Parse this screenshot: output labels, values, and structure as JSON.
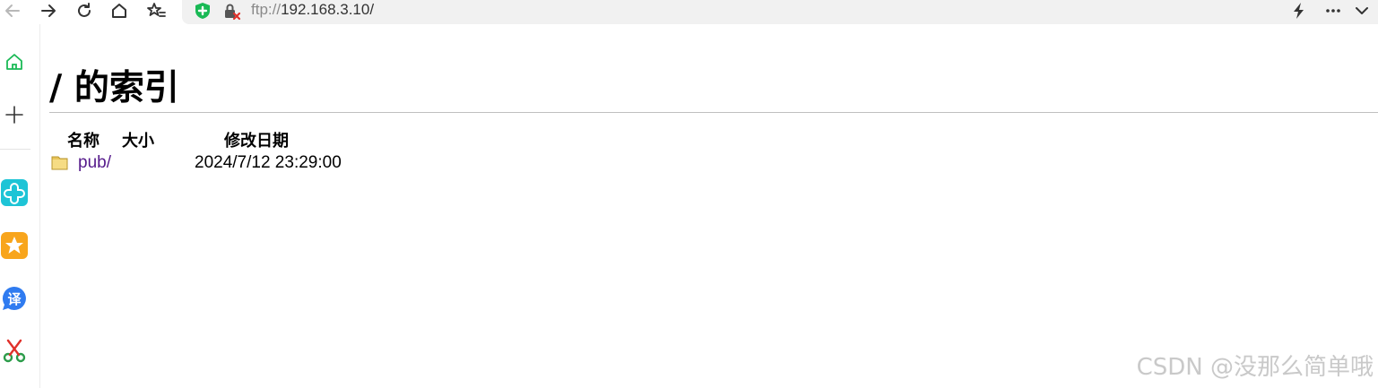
{
  "address_bar": {
    "scheme": "ftp://",
    "host": "192.168.3.10",
    "path": "/"
  },
  "page": {
    "title": "/ 的索引",
    "columns": {
      "name": "名称",
      "size": "大小",
      "modified": "修改日期"
    },
    "entries": [
      {
        "name": "pub/",
        "size": "",
        "modified": "2024/7/12 23:29:00",
        "icon": "folder-icon"
      }
    ]
  },
  "watermark": "CSDN @没那么简单哦",
  "colors": {
    "link_visited": "#551a8b",
    "accent_green": "#19b955",
    "sidebar_cyan": "#1ec4d6",
    "sidebar_orange": "#f8a51c",
    "sidebar_blue": "#2f7bf0"
  }
}
